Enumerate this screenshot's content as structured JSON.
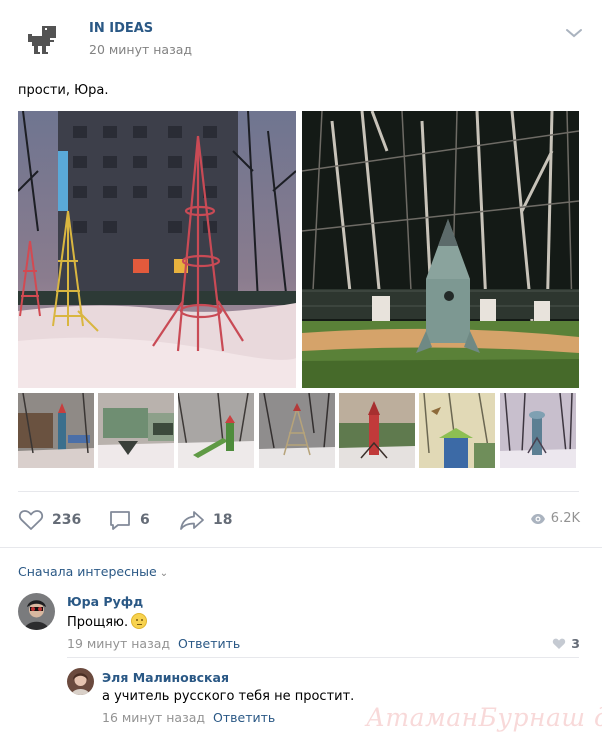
{
  "post": {
    "group_name": "IN IDEAS",
    "time": "20 минут назад",
    "text": "прости, Юра."
  },
  "actions": {
    "likes": "236",
    "comments": "6",
    "shares": "18",
    "views": "6.2K"
  },
  "comments_sort": "Сначала интересные",
  "comments": [
    {
      "author": "Юра Руфд",
      "text": "Прощяю.",
      "time": "19 минут назад",
      "reply_label": "Ответить",
      "likes": "3"
    },
    {
      "author": "Эля Малиновская",
      "text": "а учитель русского тебя не простит.",
      "time": "16 минут назад",
      "reply_label": "Ответить"
    }
  ],
  "watermark": "АтаманБурнаш для ЯП",
  "icons": {
    "menu": "chevron-down-icon",
    "like": "heart-icon",
    "comment": "comment-icon",
    "share": "share-arrow-icon",
    "views": "eye-icon",
    "comment_like": "heart-icon"
  },
  "colors": {
    "link": "#2a5885",
    "meta": "#939393",
    "divider": "#e7e8ec"
  }
}
